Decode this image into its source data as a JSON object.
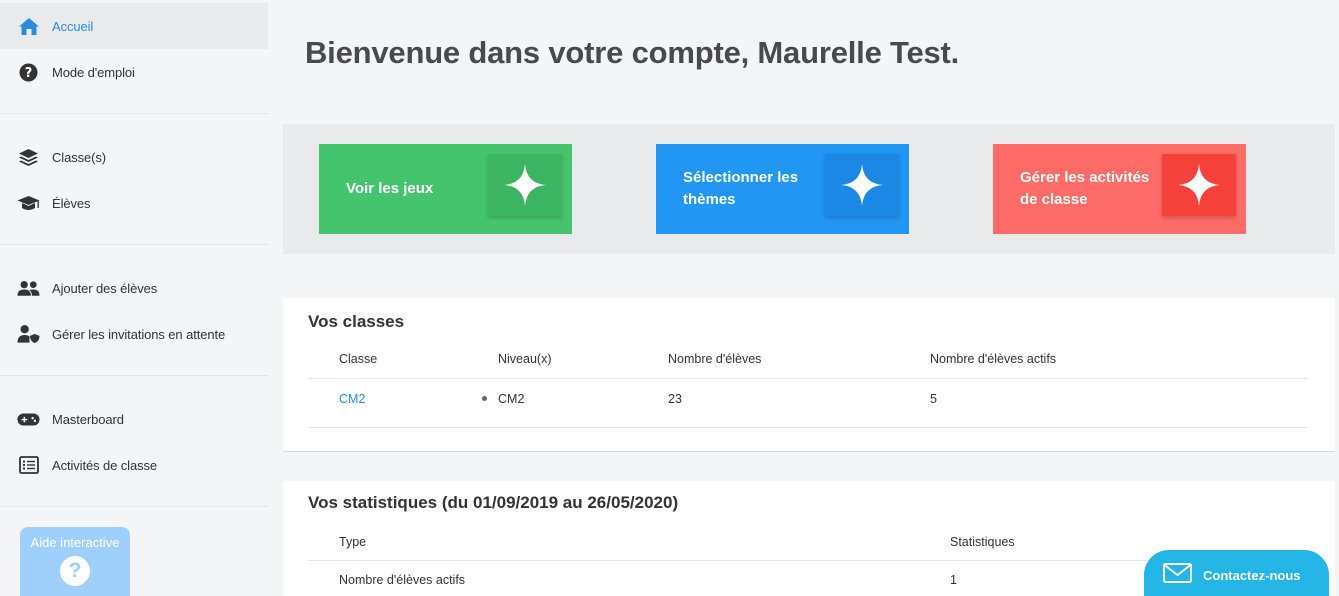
{
  "sidebar": {
    "items": [
      {
        "label": "Accueil",
        "icon": "home-icon"
      },
      {
        "label": "Mode d'emploi",
        "icon": "question-circle-icon"
      },
      {
        "label": "Classe(s)",
        "icon": "layers-icon"
      },
      {
        "label": "Élèves",
        "icon": "graduation-cap-icon"
      },
      {
        "label": "Ajouter des élèves",
        "icon": "users-icon"
      },
      {
        "label": "Gérer les invitations en attente",
        "icon": "user-shield-icon"
      },
      {
        "label": "Masterboard",
        "icon": "gamepad-icon"
      },
      {
        "label": "Activités de classe",
        "icon": "list-icon"
      }
    ],
    "help": {
      "label": "Aide interactive",
      "symbol": "?"
    }
  },
  "main": {
    "title": "Bienvenue dans votre compte, Maurelle Test.",
    "cards": [
      {
        "label": "Voir les jeux",
        "color": "#45c46e",
        "box_color": "#3cb562"
      },
      {
        "label": "Sélectionner les thèmes",
        "color": "#2196f3",
        "box_color": "#1b88e5"
      },
      {
        "label": "Gérer les activités de classe",
        "color": "#ff6b66",
        "box_color": "#f4423a"
      }
    ],
    "classes": {
      "title": "Vos classes",
      "headers": [
        "Classe",
        "Niveau(x)",
        "Nombre d'élèves",
        "Nombre d'élèves actifs"
      ],
      "rows": [
        {
          "classe": "CM2",
          "niveau": "CM2",
          "eleves": "23",
          "actifs": "5"
        }
      ]
    },
    "stats": {
      "title": "Vos statistiques (du 01/09/2019 au 26/05/2020)",
      "headers": [
        "Type",
        "Statistiques"
      ],
      "rows": [
        {
          "type": "Nombre d'élèves actifs",
          "value": "1"
        }
      ]
    }
  },
  "contact": {
    "label": "Contactez-nous",
    "icon": "envelope-icon"
  },
  "colors": {
    "accent": "#2a8cdf",
    "contact": "#22b5e6",
    "help": "#9fd0fb"
  }
}
